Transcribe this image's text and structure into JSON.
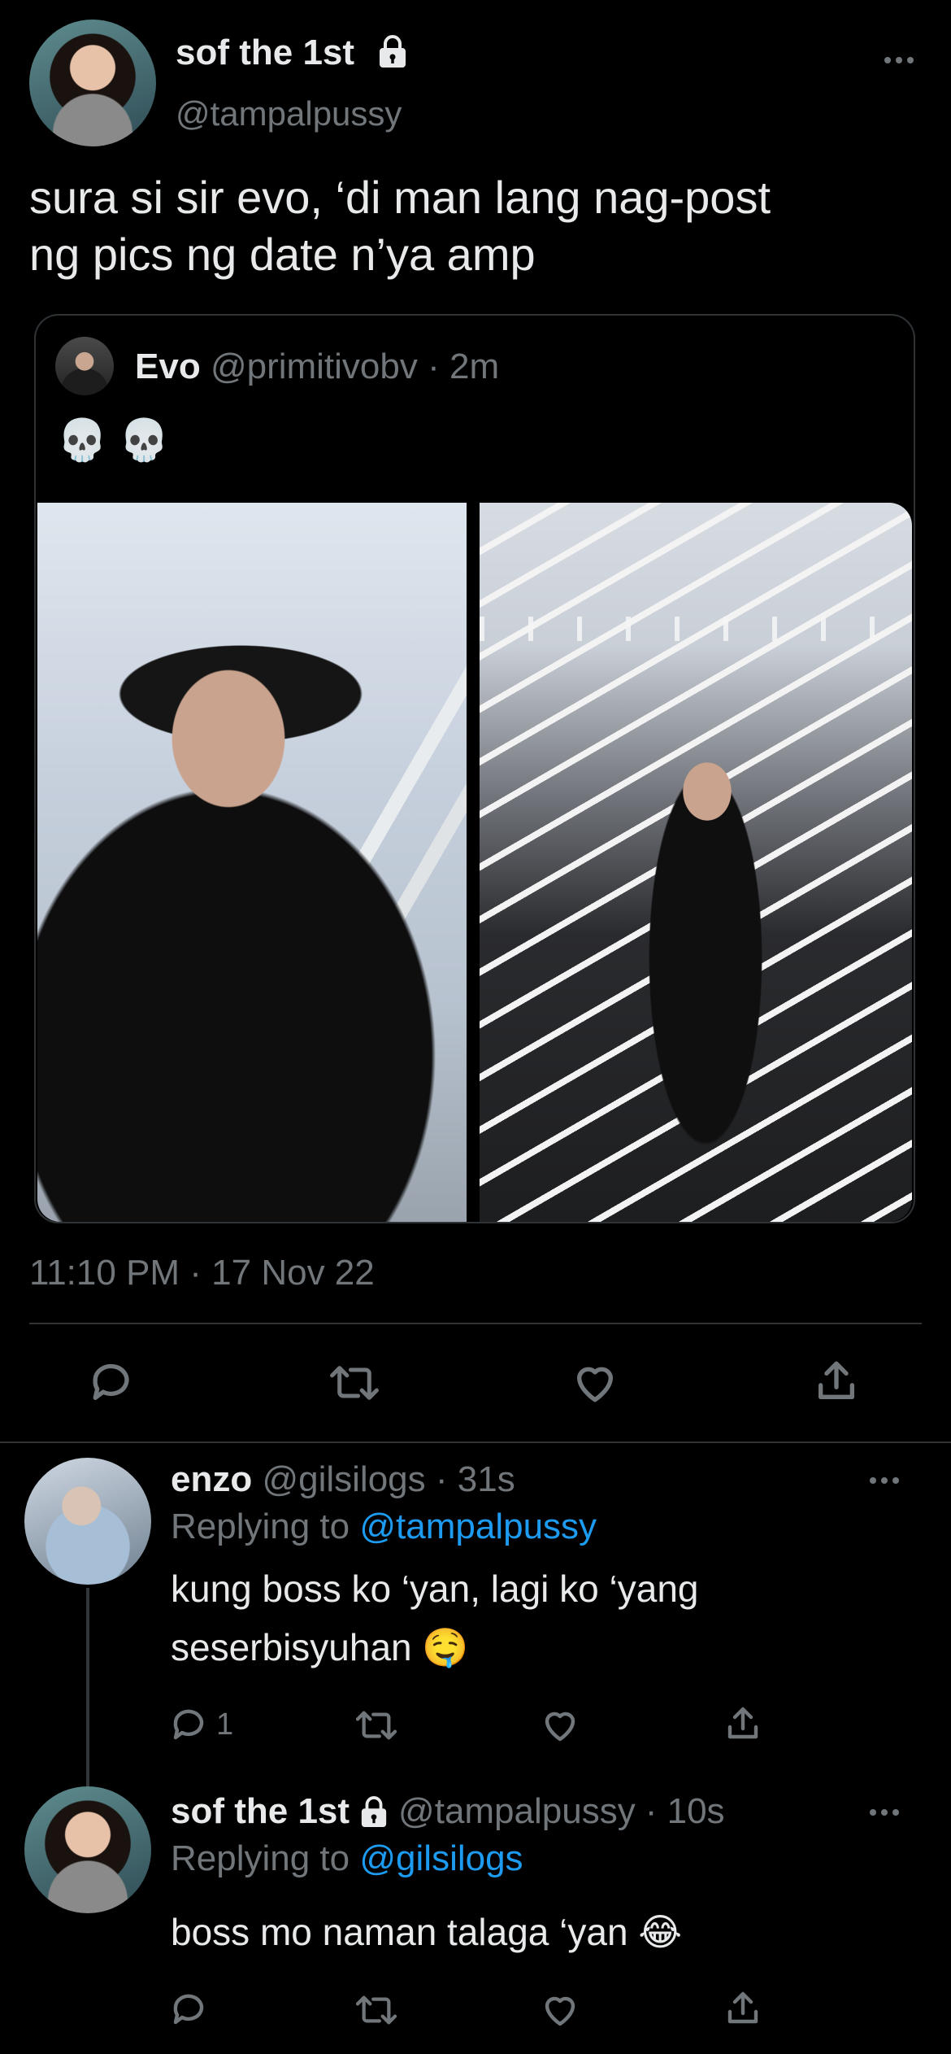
{
  "main_tweet": {
    "author_name": "sof the 1st",
    "author_handle": "@tampalpussy",
    "text_line1": "sura si sir evo, ‘di man lang nag-post",
    "text_line2": "ng pics ng date n’ya amp",
    "timestamp": "11:10 PM · 17 Nov 22"
  },
  "quoted_tweet": {
    "author_name": "Evo",
    "author_handle": "@primitivobv",
    "time": "· 2m",
    "text": "💀 💀"
  },
  "replies": [
    {
      "author_name": "enzo",
      "author_handle": "@gilsilogs",
      "time": "· 31s",
      "replying_prefix": "Replying to",
      "replying_to": "@tampalpussy",
      "text_line1": "kung boss ko ‘yan, lagi ko ‘yang",
      "text_line2": "seserbisyuhan 🤤",
      "reply_count": "1"
    },
    {
      "author_name": "sof the 1st",
      "author_handle": "@tampalpussy",
      "time": "· 10s",
      "replying_prefix": "Replying to",
      "replying_to": "@gilsilogs",
      "text_line1": "boss mo naman talaga ‘yan 😂"
    }
  ],
  "icons": {
    "more": "more-dots-icon",
    "lock": "lock-icon",
    "reply": "reply-icon",
    "retweet": "retweet-icon",
    "like": "heart-icon",
    "share": "share-icon"
  },
  "colors": {
    "background": "#000000",
    "text": "#e7e9ea",
    "muted": "#71767b",
    "link": "#1d9bf0"
  }
}
